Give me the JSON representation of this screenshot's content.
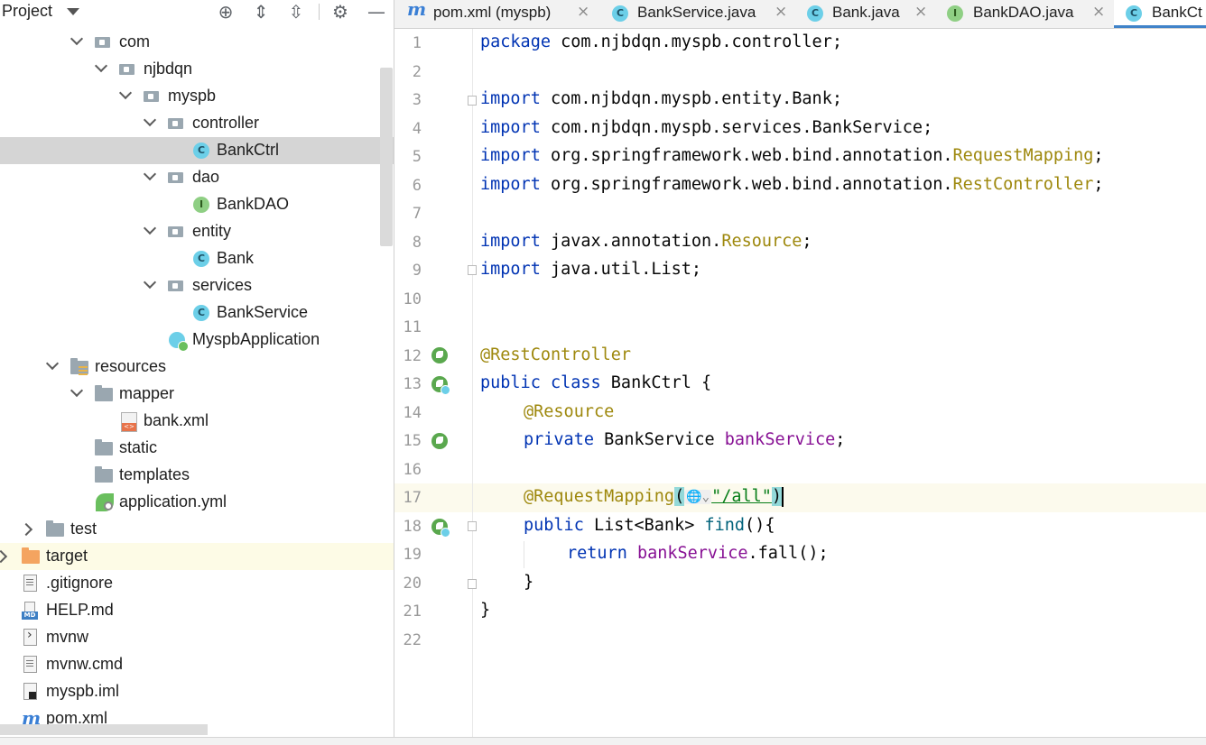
{
  "project_panel": {
    "title": "Project",
    "tree": [
      {
        "label": "com"
      },
      {
        "label": "njbdqn"
      },
      {
        "label": "myspb"
      },
      {
        "label": "controller"
      },
      {
        "label": "BankCtrl"
      },
      {
        "label": "dao"
      },
      {
        "label": "BankDAO"
      },
      {
        "label": "entity"
      },
      {
        "label": "Bank"
      },
      {
        "label": "services"
      },
      {
        "label": "BankService"
      },
      {
        "label": "MyspbApplication"
      },
      {
        "label": "resources"
      },
      {
        "label": "mapper"
      },
      {
        "label": "bank.xml"
      },
      {
        "label": "static"
      },
      {
        "label": "templates"
      },
      {
        "label": "application.yml"
      },
      {
        "label": "test"
      },
      {
        "label": "target"
      },
      {
        "label": ".gitignore"
      },
      {
        "label": "HELP.md"
      },
      {
        "label": "mvnw"
      },
      {
        "label": "mvnw.cmd"
      },
      {
        "label": "myspb.iml"
      },
      {
        "label": "pom.xml"
      }
    ]
  },
  "tabs": [
    {
      "label": "pom.xml (myspb)",
      "icon": "m"
    },
    {
      "label": "BankService.java",
      "icon": "C"
    },
    {
      "label": "Bank.java",
      "icon": "C"
    },
    {
      "label": "BankDAO.java",
      "icon": "I"
    },
    {
      "label": "BankCt",
      "icon": "C"
    }
  ],
  "editor": {
    "line_numbers": [
      "1",
      "2",
      "3",
      "4",
      "5",
      "6",
      "7",
      "8",
      "9",
      "10",
      "11",
      "12",
      "13",
      "14",
      "15",
      "16",
      "17",
      "18",
      "19",
      "20",
      "21",
      "22"
    ],
    "tokens": {
      "l1_kw": "package",
      "l1_rest": " com.njbdqn.myspb.controller;",
      "import": "import",
      "l3_rest": " com.njbdqn.myspb.entity.Bank;",
      "l4_rest": " com.njbdqn.myspb.services.BankService;",
      "l5_pre": " org.springframework.web.bind.annotation.",
      "l5_ann": "RequestMapping",
      "semi": ";",
      "l6_pre": " org.springframework.web.bind.annotation.",
      "l6_ann": "RestController",
      "l8_pre": " javax.annotation.",
      "l8_ann": "Resource",
      "l9_rest": " java.util.List;",
      "l12_ann": "@RestController",
      "l13_kw": "public class",
      "l13_rest": " BankCtrl {",
      "l14_ann": "@Resource",
      "l15_kw": "private",
      "l15_mid": " BankService ",
      "l15_field": "bankService",
      "l15_end": ";",
      "l17_ann": "@RequestMapping",
      "l17_open": "(",
      "l17_str": "\"/all\"",
      "l17_close": ")",
      "l18_kw": "public",
      "l18_rest": " List<Bank> ",
      "l18_fn": "find",
      "l18_end": "(){",
      "l19_kw": "return",
      "l19_sp": " ",
      "l19_field": "bankService",
      "l19_end": ".fall();",
      "l20": "}",
      "l21": "}"
    }
  },
  "colors": {
    "keyword": "#0033b3",
    "annotation": "#9e880d",
    "field": "#871094",
    "string": "#067d17",
    "active_tab_underline": "#4083c9"
  }
}
